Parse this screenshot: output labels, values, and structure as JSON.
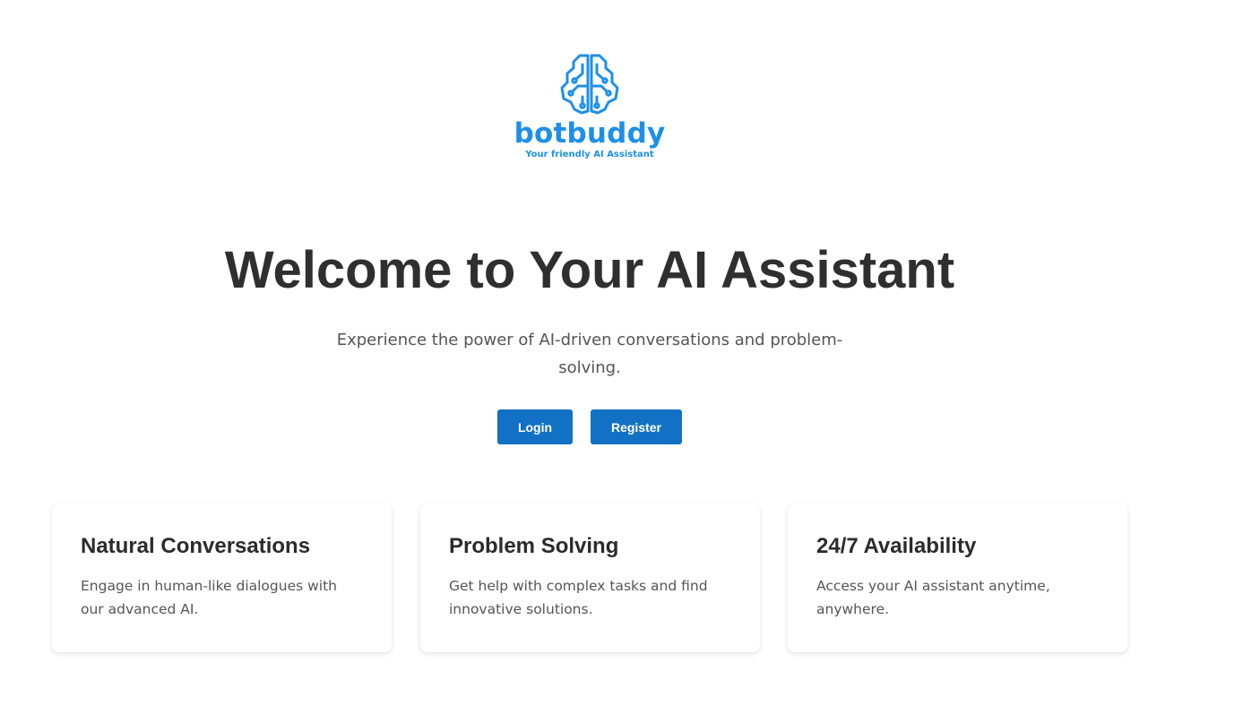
{
  "brand": {
    "name": "botbuddy",
    "tagline": "Your friendly AI Assistant",
    "logo_icon": "brain-circuit-icon",
    "color": "#1e8fe8"
  },
  "hero": {
    "title": "Welcome to Your AI Assistant",
    "subtitle": "Experience the power of AI-driven conversations and problem-solving."
  },
  "actions": {
    "login_label": "Login",
    "register_label": "Register",
    "button_color": "#1271c4"
  },
  "features": [
    {
      "title": "Natural Conversations",
      "description": "Engage in human-like dialogues with our advanced AI."
    },
    {
      "title": "Problem Solving",
      "description": "Get help with complex tasks and find innovative solutions."
    },
    {
      "title": "24/7 Availability",
      "description": "Access your AI assistant anytime, anywhere."
    }
  ]
}
